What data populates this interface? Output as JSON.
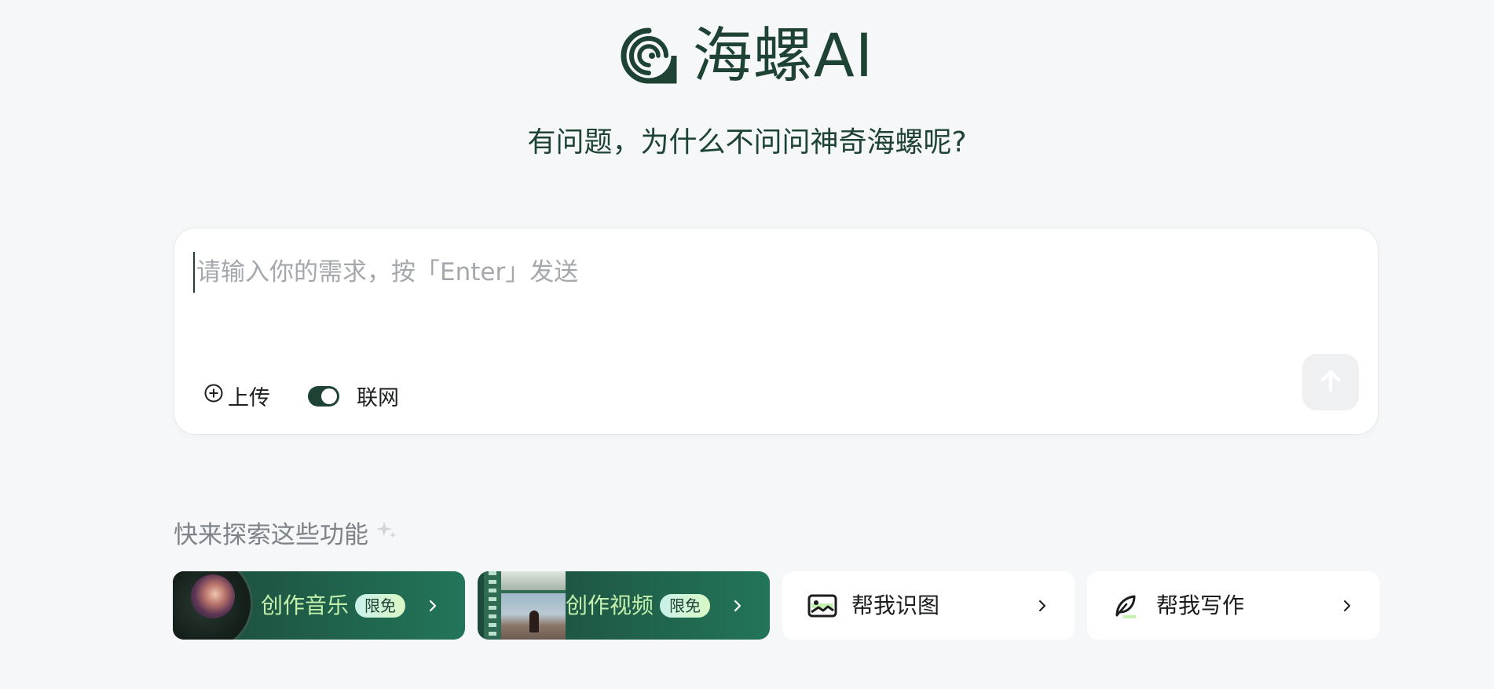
{
  "logo": {
    "text": "海螺AI",
    "icon": "snail-shell-icon"
  },
  "subtitle": "有问题，为什么不问问神奇海螺呢?",
  "input": {
    "placeholder": "请输入你的需求，按「Enter」发送",
    "value": ""
  },
  "toolbar": {
    "upload_label": "上传",
    "web_label": "联网",
    "web_enabled": true
  },
  "explore": {
    "title": "快来探索这些功能"
  },
  "features": [
    {
      "label": "创作音乐",
      "badge": "限免",
      "icon": "vinyl-record-icon"
    },
    {
      "label": "创作视频",
      "badge": "限免",
      "icon": "film-strip-icon"
    },
    {
      "label": "帮我识图",
      "icon": "image-icon"
    },
    {
      "label": "帮我写作",
      "icon": "feather-pen-icon"
    }
  ],
  "colors": {
    "brand": "#1e4334",
    "accent_green": "#c4f1ad",
    "background": "#f5f7f8"
  }
}
